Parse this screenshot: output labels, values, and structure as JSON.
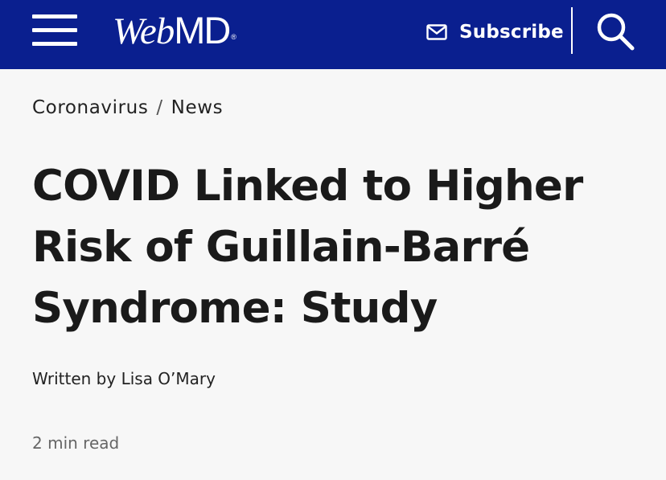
{
  "header": {
    "logo_web": "Web",
    "logo_md": "MD",
    "logo_reg": "®",
    "subscribe_label": "Subscribe",
    "menu_icon": "hamburger-menu-icon",
    "mail_icon": "mail-icon",
    "search_icon": "search-icon",
    "background_color": "#0a1f8f"
  },
  "breadcrumb": {
    "items": [
      "Coronavirus",
      "News"
    ],
    "separator": "/"
  },
  "article": {
    "headline": "COVID Linked to Higher Risk of Guillain-Barré Syndrome: Study",
    "byline_prefix": "Written by",
    "author": "Lisa O’Mary",
    "read_time": "2 min read"
  }
}
